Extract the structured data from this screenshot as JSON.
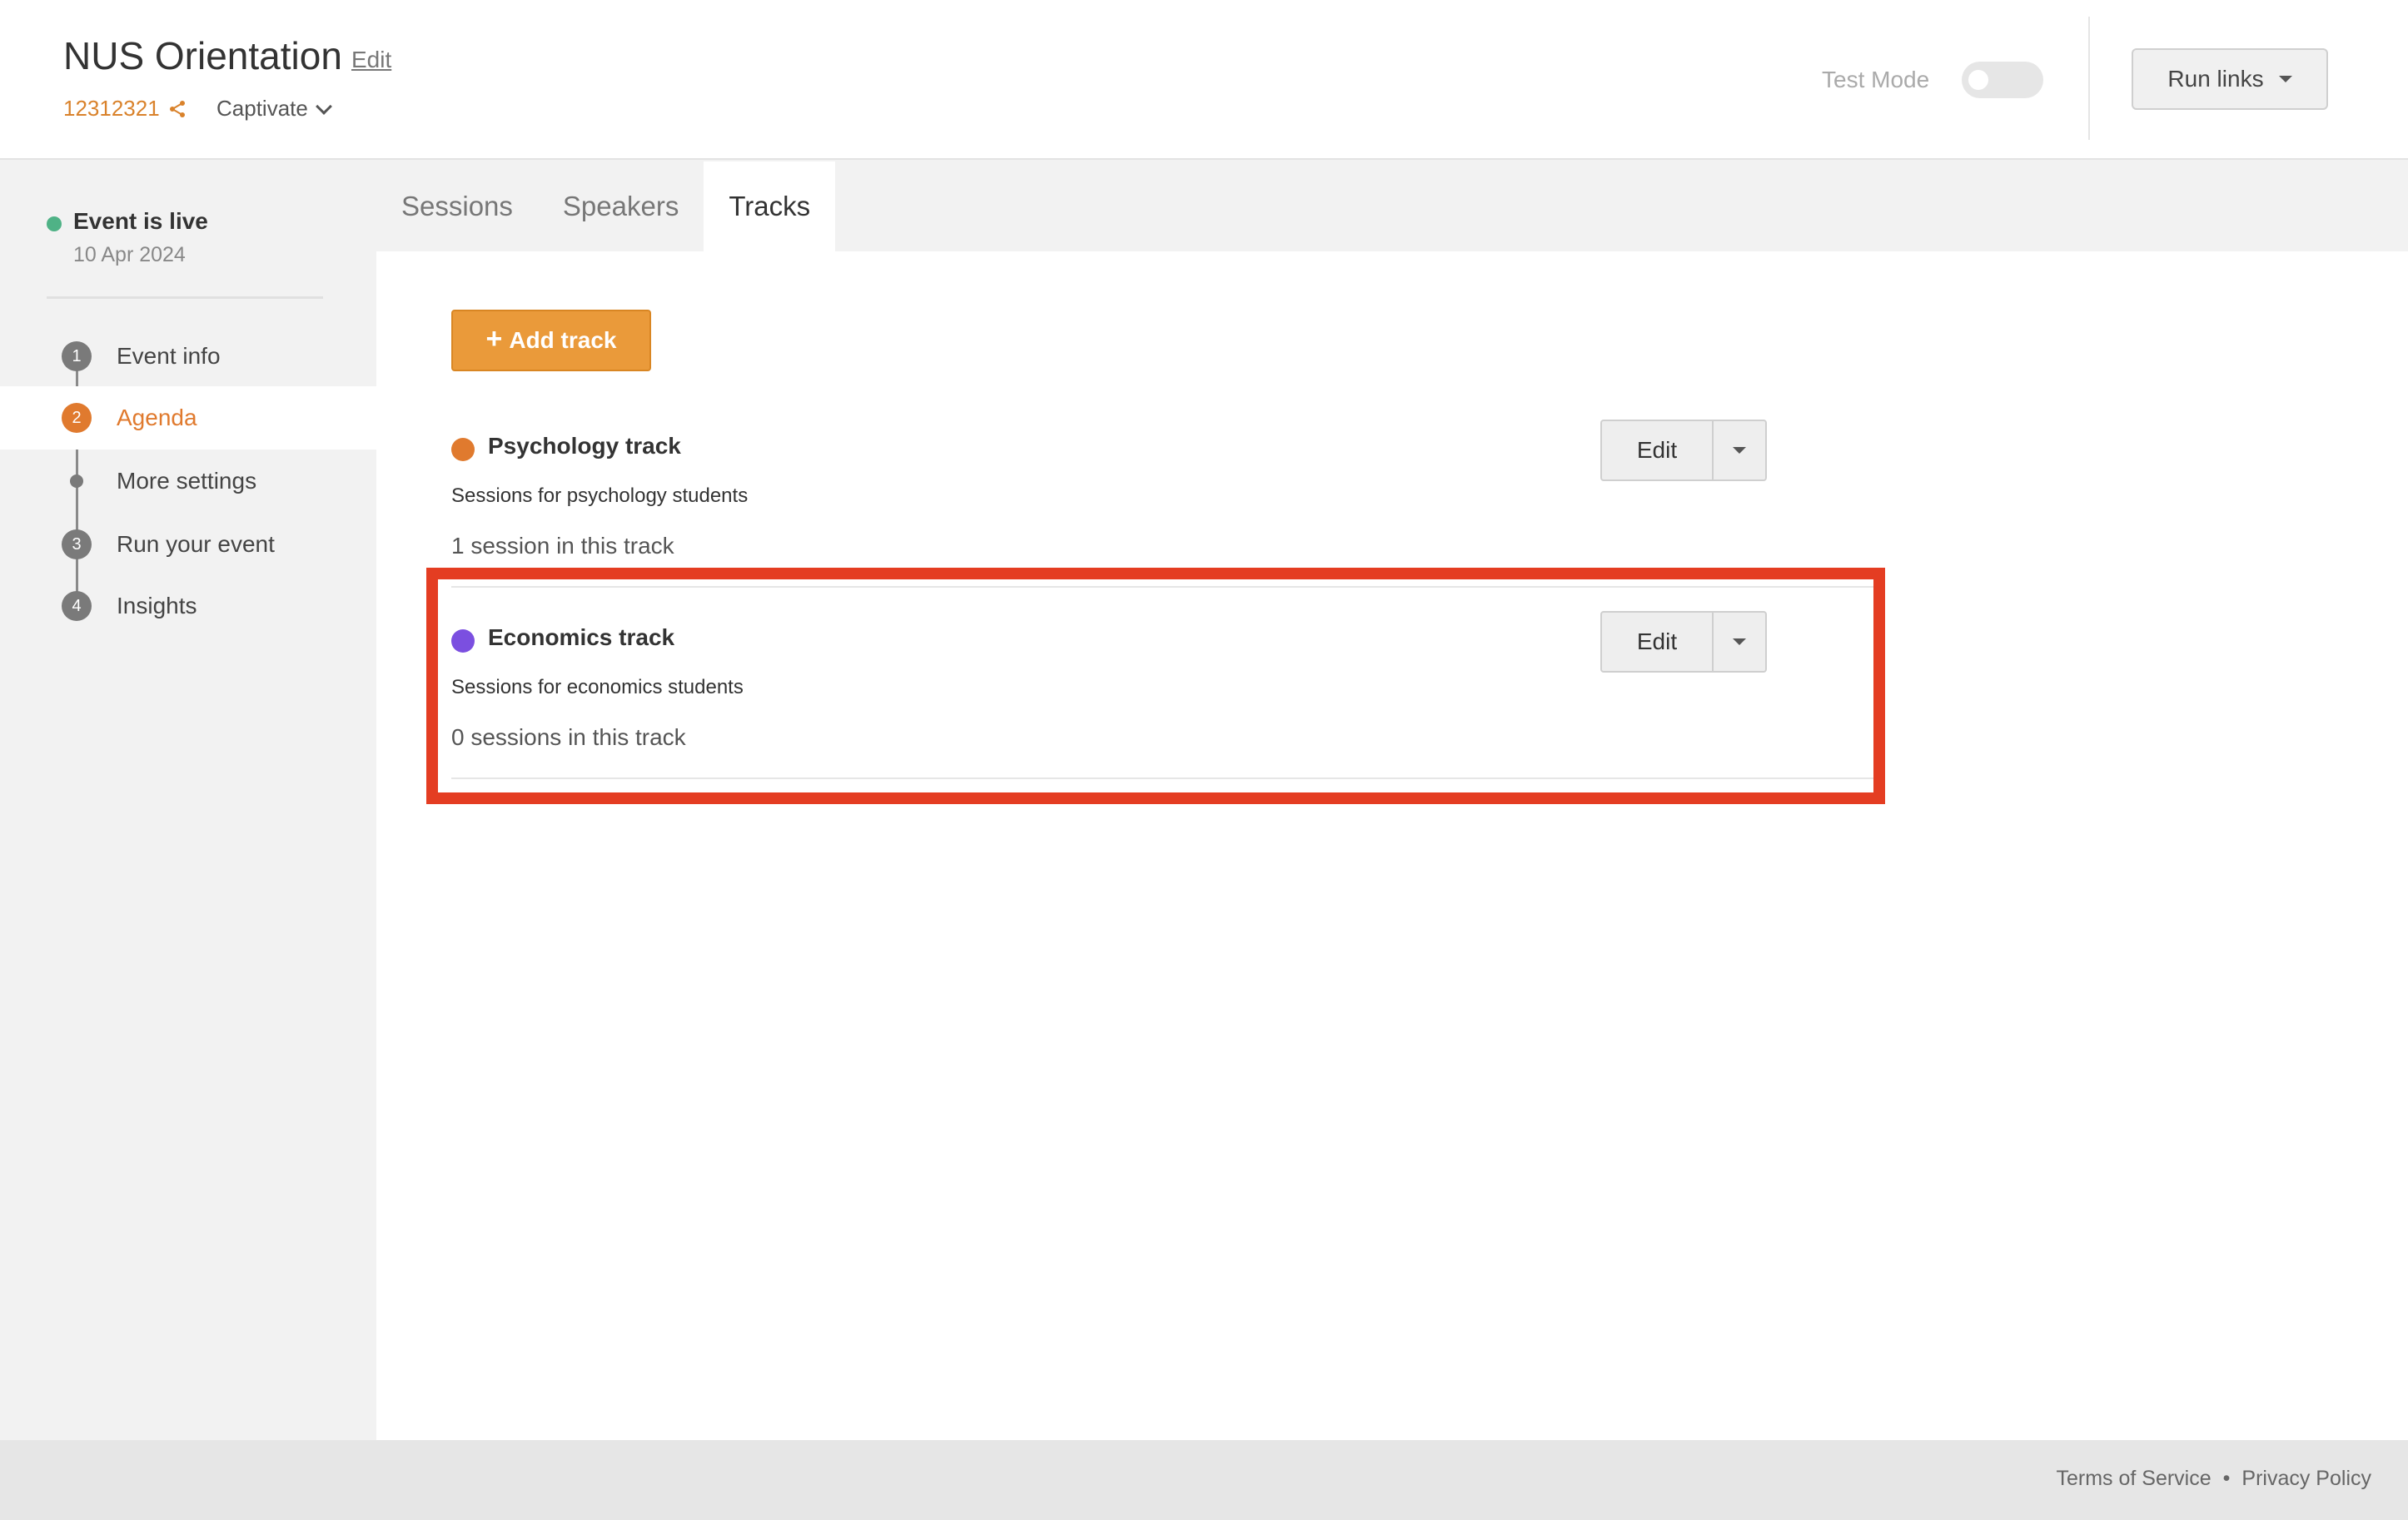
{
  "header": {
    "event_title": "NUS Orientation",
    "edit_label": "Edit",
    "event_id": "12312321",
    "organization": "Captivate",
    "test_mode_label": "Test Mode",
    "test_mode_on": false,
    "run_links_label": "Run links"
  },
  "sidebar": {
    "status_label": "Event is live",
    "status_date": "10 Apr 2024",
    "status_color": "#4fb286",
    "items": [
      {
        "number": "1",
        "label": "Event info",
        "active": false
      },
      {
        "number": "2",
        "label": "Agenda",
        "active": true
      },
      {
        "number": "",
        "label": "More settings",
        "active": false
      },
      {
        "number": "3",
        "label": "Run your event",
        "active": false
      },
      {
        "number": "4",
        "label": "Insights",
        "active": false
      }
    ]
  },
  "tabs": [
    {
      "label": "Sessions",
      "active": false
    },
    {
      "label": "Speakers",
      "active": false
    },
    {
      "label": "Tracks",
      "active": true
    }
  ],
  "main": {
    "add_track_label": "Add track",
    "tracks": [
      {
        "name": "Psychology track",
        "color": "#e07a2e",
        "description": "Sessions for psychology students",
        "count_text": "1 session in this track",
        "edit_label": "Edit"
      },
      {
        "name": "Economics track",
        "color": "#7b4fe0",
        "description": "Sessions for economics students",
        "count_text": "0 sessions in this track",
        "edit_label": "Edit"
      }
    ]
  },
  "footer": {
    "terms_label": "Terms of Service",
    "separator": "•",
    "privacy_label": "Privacy Policy"
  },
  "colors": {
    "accent": "#e07a2e",
    "button_orange": "#ea9a3a",
    "highlight_red": "#e43d22"
  }
}
